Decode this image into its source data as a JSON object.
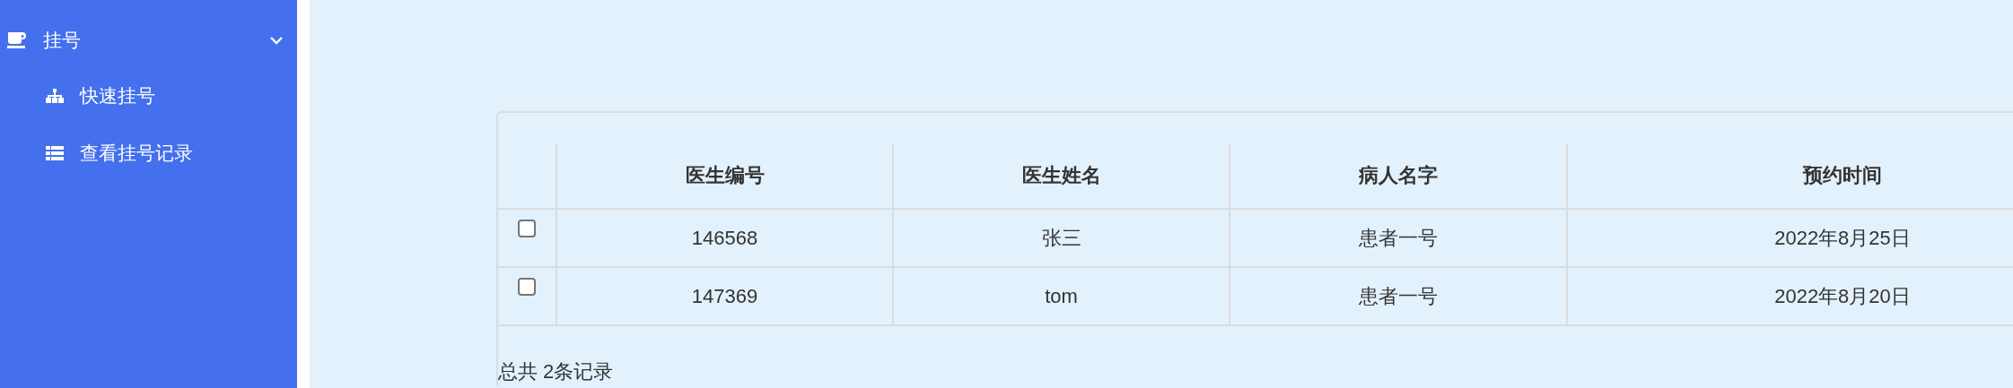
{
  "sidebar": {
    "group": {
      "label": "挂号",
      "expanded": true,
      "items": [
        {
          "label": "快速挂号",
          "kind": "sitemap"
        },
        {
          "label": "查看挂号记录",
          "kind": "list"
        }
      ]
    }
  },
  "table": {
    "columns": [
      "医生编号",
      "医生姓名",
      "病人名字",
      "预约时间"
    ],
    "rows": [
      {
        "checked": false,
        "cells": [
          "146568",
          "张三",
          "患者一号",
          "2022年8月25日"
        ]
      },
      {
        "checked": false,
        "cells": [
          "147369",
          "tom",
          "患者一号",
          "2022年8月20日"
        ]
      }
    ]
  },
  "footer": "总共 2条记录"
}
